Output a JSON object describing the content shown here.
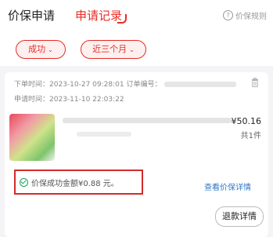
{
  "header": {
    "tab_main": "价保申请",
    "tab_records": "申请记录",
    "rules_label": "价保规则"
  },
  "filters": {
    "status": "成功",
    "period": "近三个月"
  },
  "record": {
    "order_time_label": "下单时间：",
    "order_time": "2023-10-27 09:28:01",
    "order_no_label": "订单编号：",
    "apply_time_label": "申请时间：",
    "apply_time": "2023-11-10 22:03:22",
    "price": "¥50.16",
    "quantity": "共1件",
    "success_text": "价保成功金额¥0.88 元。",
    "detail_link": "查看价保详情",
    "refund_button": "退款详情"
  },
  "colors": {
    "accent": "#e62c27",
    "link": "#2f78c4",
    "success_icon": "#1aa260"
  }
}
